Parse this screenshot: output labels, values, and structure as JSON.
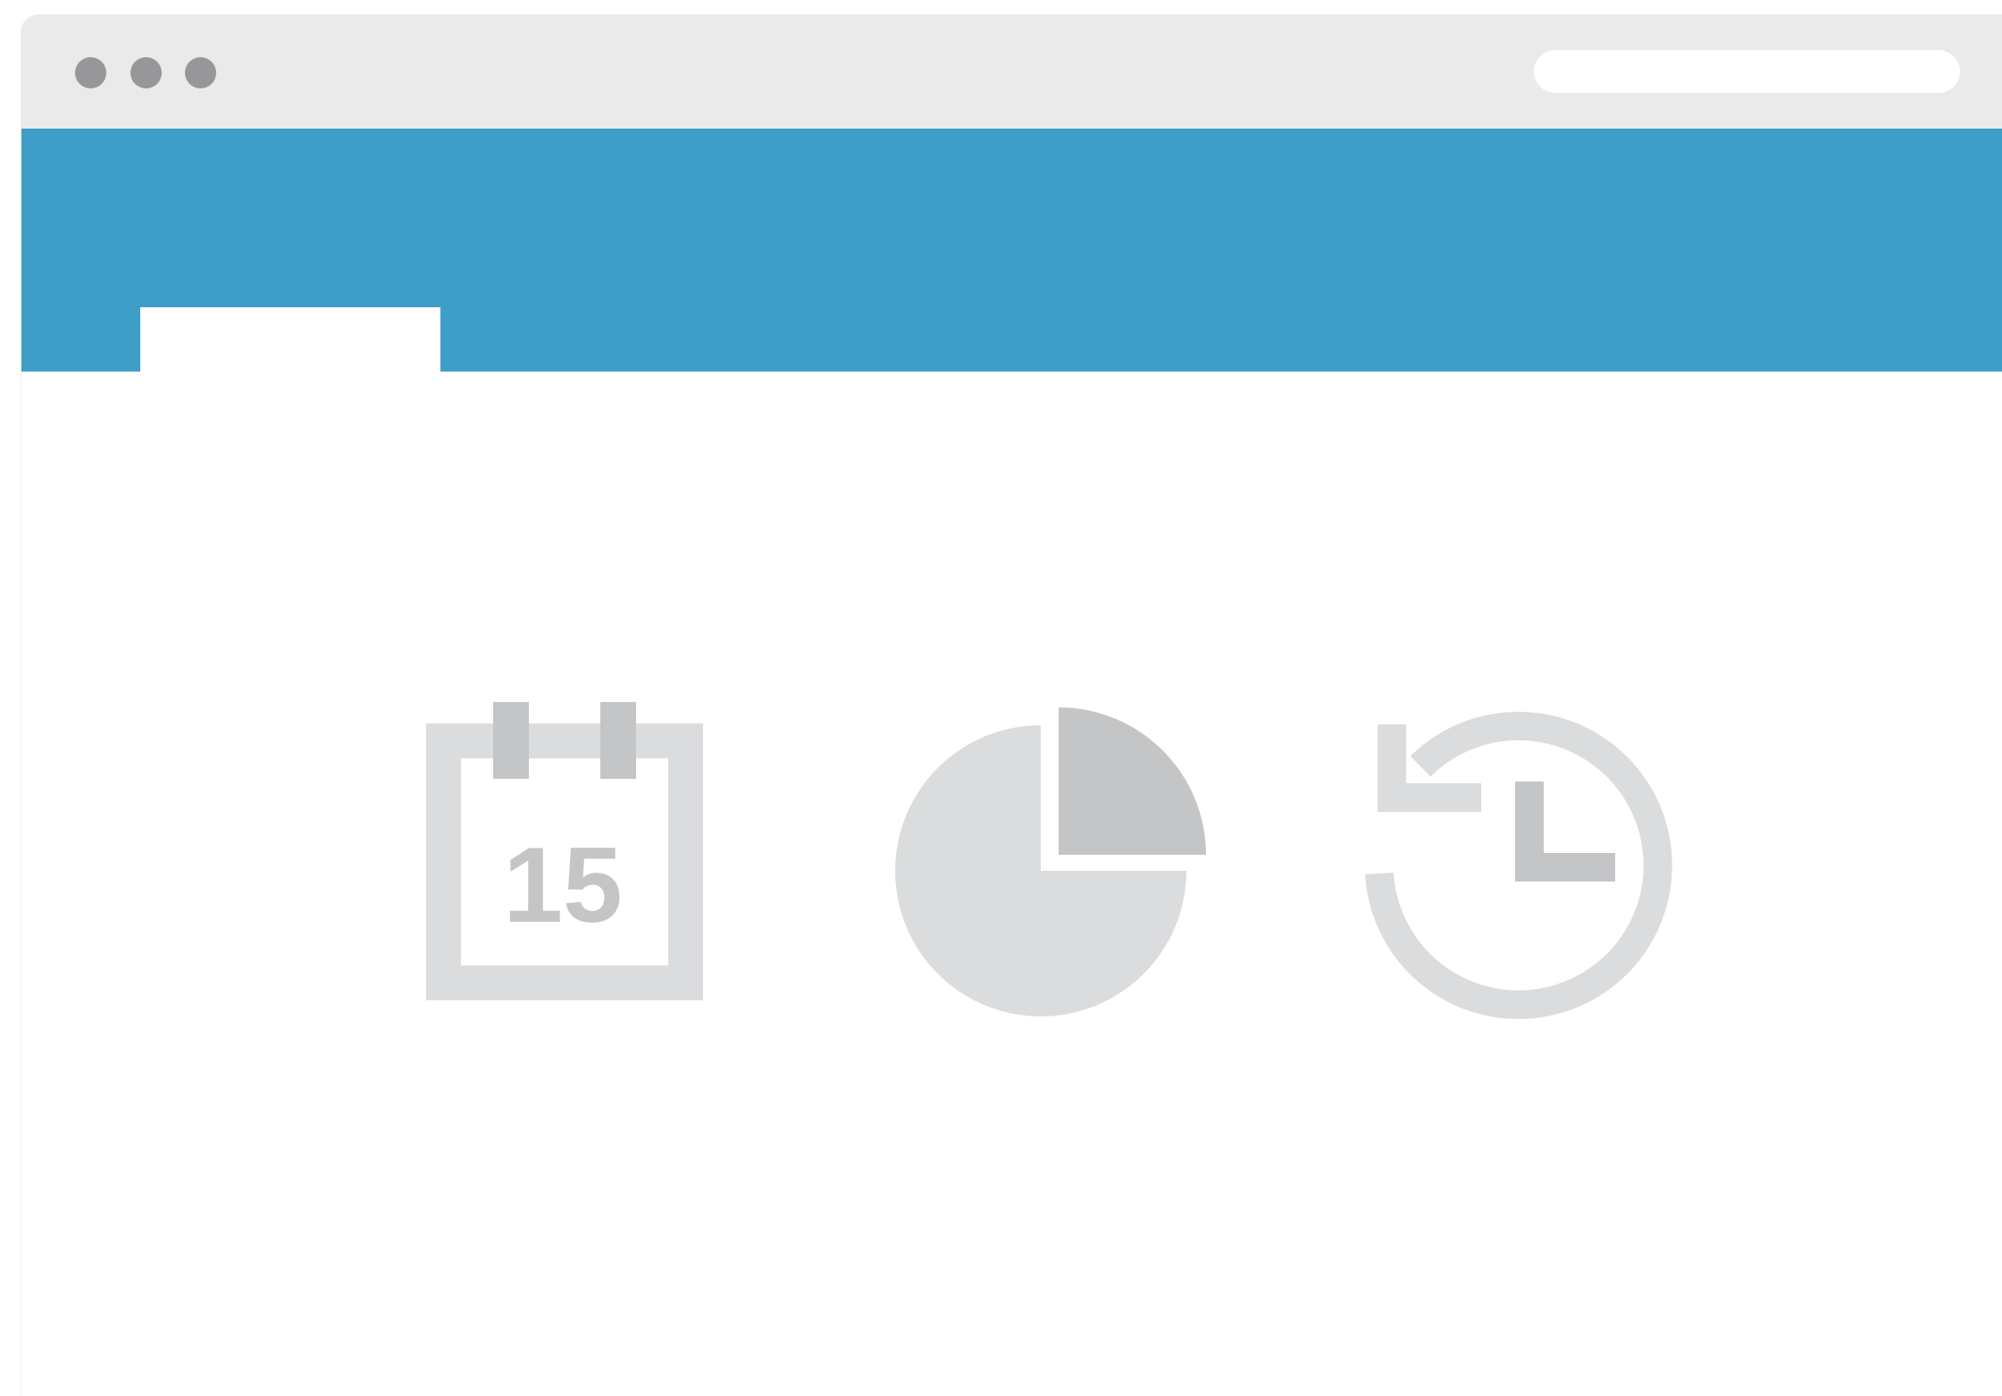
{
  "window": {
    "address_bar": {
      "value": "",
      "placeholder": ""
    }
  },
  "tabs": [
    {
      "label": "",
      "active": true
    }
  ],
  "colors": {
    "header": "#3f9ec7",
    "titlebar": "#eaeaea",
    "window_dots": "#97979a",
    "icon_light": "#dbdcdd",
    "icon_dark": "#c4c5c6"
  },
  "feature_icons": [
    {
      "icon": "calendar-icon",
      "text": "15"
    },
    {
      "icon": "pie-chart-icon"
    },
    {
      "icon": "history-icon"
    }
  ]
}
